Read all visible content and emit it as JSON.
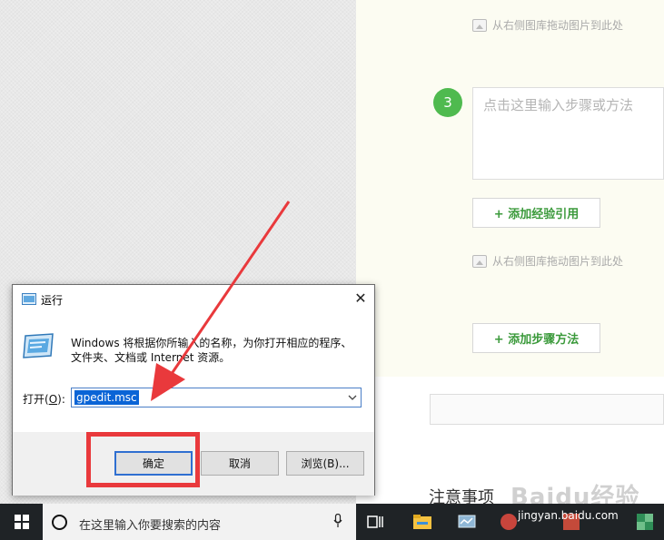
{
  "editor": {
    "image_hint_1": "从右侧图库拖动图片到此处",
    "step_number": "3",
    "step_placeholder": "点击这里输入步骤或方法",
    "add_reference_label": "+ 添加经验引用",
    "image_hint_2": "从右侧图库拖动图片到此处",
    "add_step_label": "+ 添加步骤方法",
    "notes_title": "注意事项",
    "watermark_text": "Baidu经验",
    "watermark_url": "jingyan.baidu.com"
  },
  "run_dialog": {
    "title": "运行",
    "description": "Windows 将根据你所输入的名称，为你打开相应的程序、文件夹、文档或 Internet 资源。",
    "open_label": "打开(",
    "open_label_key": "O",
    "open_label_end": "):",
    "input_value": "gpedit.msc",
    "ok_label": "确定",
    "cancel_label": "取消",
    "browse_label": "浏览(B)...",
    "close_glyph": "✕"
  },
  "taskbar": {
    "search_placeholder": "在这里输入你要搜索的内容"
  },
  "colors": {
    "accent_green": "#4fba4f",
    "highlight_red": "#e9393c",
    "selection_blue": "#0a64d6",
    "taskbar": "#1f2326"
  },
  "icons": [
    "image-icon",
    "run-app-icon",
    "close-icon",
    "chevron-down-icon",
    "windows-logo-icon",
    "search-icon",
    "microphone-icon",
    "task-view-icon",
    "file-explorer-icon",
    "control-panel-icon",
    "taskbar-app-icon"
  ]
}
